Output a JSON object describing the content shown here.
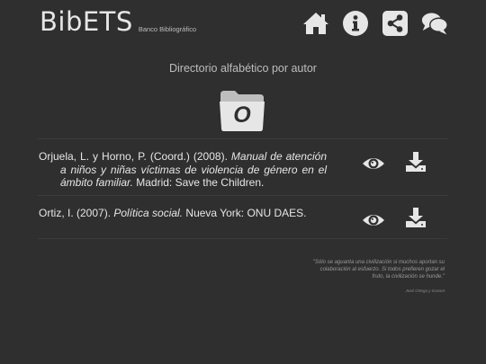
{
  "brand": {
    "name": "BibETS",
    "subtitle": "Banco Bibliográfico"
  },
  "nav": {
    "icons": [
      "home-icon",
      "info-icon",
      "share-icon",
      "chat-icon"
    ]
  },
  "page": {
    "heading": "Directorio alfabético por autor",
    "letter": "O"
  },
  "entries": [
    {
      "authors": "Orjuela, L. y Horno, P. (Coord.) (2008). ",
      "title": "Manual de atención a niños y niñas víctimas de violencia de género en el ámbito familiar.",
      "publisher": " Madrid: Save the Children."
    },
    {
      "authors": "Ortiz, I. (2007). ",
      "title": "Política social.",
      "publisher": " Nueva York: ONU DAES."
    }
  ],
  "footer": {
    "quote": "\"Sólo se aguanta una civilización si muchos aportan su colaboración al esfuerzo. Si todos prefieren gozar el fruto, la civilización se hunde.\"",
    "author": "José Ortega y Gasset"
  },
  "colors": {
    "background": "#2f2f2f",
    "text": "#e6e6e6",
    "muted": "#bdbdbd",
    "icon": "#e6e6e6"
  }
}
